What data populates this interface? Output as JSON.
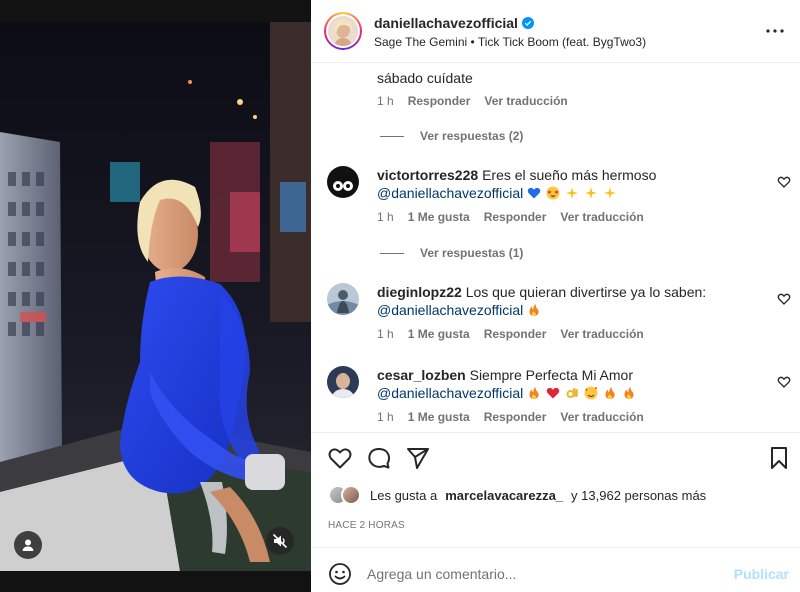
{
  "header": {
    "username": "daniellachavezofficial",
    "audio": "Sage The Gemini • Tick Tick Boom (feat. BygTwo3)",
    "verified_icon": "verified-badge-icon",
    "more_icon": "more-options-icon"
  },
  "comments": [
    {
      "partial": true,
      "text": "sábado cuídate",
      "meta": {
        "time": "1 h",
        "reply": "Responder",
        "translate": "Ver traducción"
      },
      "replies": "Ver respuestas (2)"
    },
    {
      "username": "victortorres228",
      "text": "Eres el sueño más hermoso",
      "mention": "@daniellachavezofficial",
      "emoji_names": [
        "blue-heart",
        "star-struck",
        "sparkles",
        "sparkles",
        "sparkles"
      ],
      "meta": {
        "time": "1 h",
        "likes": "1 Me gusta",
        "reply": "Responder",
        "translate": "Ver traducción"
      },
      "replies": "Ver respuestas (1)"
    },
    {
      "username": "dieginlopz22",
      "text": "Los que quieran divertirse ya lo saben:",
      "mention": "@daniellachavezofficial",
      "emoji_names": [
        "fire"
      ],
      "meta": {
        "time": "1 h",
        "likes": "1 Me gusta",
        "reply": "Responder",
        "translate": "Ver traducción"
      }
    },
    {
      "username": "cesar_lozben",
      "text": "Siempre Perfecta Mi Amor",
      "mention": "@daniellachavezofficial",
      "emoji_names": [
        "fire",
        "red-heart",
        "ok-hand",
        "smiling-hearts",
        "fire",
        "fire"
      ],
      "meta": {
        "time": "1 h",
        "likes": "1 Me gusta",
        "reply": "Responder",
        "translate": "Ver traducción"
      }
    }
  ],
  "likes": {
    "prefix": "Les gusta a",
    "user": "marcelavacarezza_",
    "suffix": "y 13,962 personas más"
  },
  "timestamp": "HACE 2 HORAS",
  "composer": {
    "placeholder": "Agrega un comentario...",
    "post_label": "Publicar"
  },
  "colors": {
    "link": "#00376b",
    "muted": "#737373",
    "verified": "#0095f6",
    "post_disabled": "#b2dffc",
    "dress_blue": "#1f3bd8"
  }
}
